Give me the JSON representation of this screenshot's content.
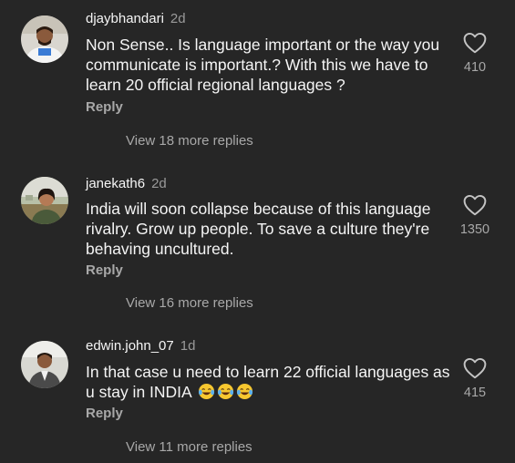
{
  "comments": [
    {
      "username": "djaybhandari",
      "time": "2d",
      "text": "Non Sense.. Is language important or the way you communicate is important.? With this we have to learn 20 official regional languages ?",
      "reply_label": "Reply",
      "more_replies": "View 18 more replies",
      "likes": "410"
    },
    {
      "username": "janekath6",
      "time": "2d",
      "text": "India will soon collapse because of this language rivalry. Grow up people. To save a culture they're behaving uncultured.",
      "reply_label": "Reply",
      "more_replies": "View 16 more replies",
      "likes": "1350"
    },
    {
      "username": "edwin.john_07",
      "time": "1d",
      "text": "In that case u need to learn 22 official languages as u stay in INDIA",
      "emojis": [
        "face-with-tears-of-joy",
        "face-with-tears-of-joy",
        "face-with-tears-of-joy"
      ],
      "reply_label": "Reply",
      "more_replies": "View 11 more replies",
      "likes": "415"
    }
  ],
  "colors": {
    "background": "#262626",
    "text": "#f5f5f5",
    "muted": "#a8a8a8"
  }
}
